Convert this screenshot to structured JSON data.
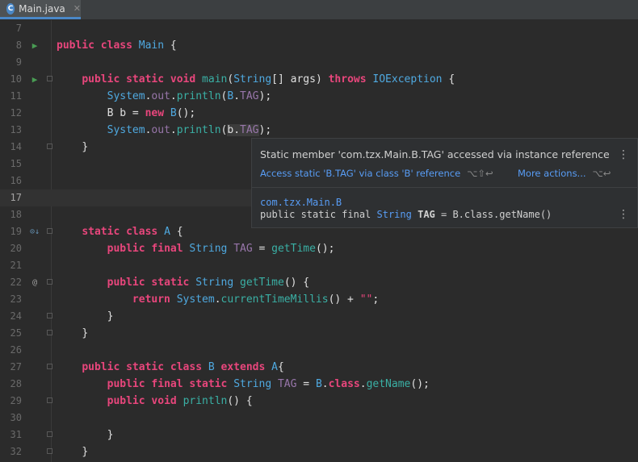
{
  "tab": {
    "icon": "C",
    "title": "Main.java",
    "close_icon": "✕"
  },
  "lines": [
    {
      "n": "7"
    },
    {
      "n": "8"
    },
    {
      "n": "9"
    },
    {
      "n": "10"
    },
    {
      "n": "11"
    },
    {
      "n": "12"
    },
    {
      "n": "13"
    },
    {
      "n": "14"
    },
    {
      "n": "15"
    },
    {
      "n": "16"
    },
    {
      "n": "17"
    },
    {
      "n": "18"
    },
    {
      "n": "19"
    },
    {
      "n": "20"
    },
    {
      "n": "21"
    },
    {
      "n": "22"
    },
    {
      "n": "23"
    },
    {
      "n": "24"
    },
    {
      "n": "25"
    },
    {
      "n": "26"
    },
    {
      "n": "27"
    },
    {
      "n": "28"
    },
    {
      "n": "29"
    },
    {
      "n": "30"
    },
    {
      "n": "31"
    },
    {
      "n": "32"
    }
  ],
  "code": {
    "l8": [
      "public",
      "class",
      "Main",
      "{"
    ],
    "l10": [
      "public",
      "static",
      "void",
      "main",
      "(",
      "String",
      "[] args) ",
      "throws",
      "IOException",
      "{"
    ],
    "l11": [
      "System",
      ".",
      "out",
      ".",
      "println",
      "(",
      "B",
      ".",
      "TAG",
      ");"
    ],
    "l12": [
      "B b = ",
      "new",
      "B",
      "();"
    ],
    "l13": [
      "System",
      ".",
      "out",
      ".",
      "println",
      "(",
      "b",
      ".",
      "TAG",
      ");"
    ],
    "l14": [
      "}"
    ],
    "l19": [
      "static",
      "class",
      "A",
      "{"
    ],
    "l20": [
      "public",
      "final",
      "String",
      "TAG",
      " = ",
      "getTime",
      "();"
    ],
    "l22": [
      "public",
      "static",
      "String",
      "getTime",
      "() {"
    ],
    "l23": [
      "return",
      "System",
      ".",
      "currentTimeMillis",
      "() + ",
      "\"\"",
      ";"
    ],
    "l24": [
      "}"
    ],
    "l25": [
      "}"
    ],
    "l27": [
      "public",
      "static",
      "class",
      "B",
      "extends",
      "A",
      "{"
    ],
    "l28": [
      "public",
      "final",
      "static",
      "String",
      "TAG",
      " = ",
      "B",
      ".",
      "class",
      ".",
      "getName",
      "();"
    ],
    "l29": [
      "public",
      "void",
      "println",
      "() {"
    ],
    "l31": [
      "}"
    ],
    "l32": [
      "}"
    ]
  },
  "gutter_icons": {
    "run": "▶",
    "override": "⊙↓",
    "at": "@"
  },
  "popup": {
    "title": "Static member 'com.tzx.Main.B.TAG' accessed via instance reference",
    "action": "Access static 'B.TAG' via class 'B' reference",
    "action_shortcut": "⌥⇧↩",
    "more": "More actions...",
    "more_shortcut": "⌥↩",
    "decl_class": "com.tzx.Main.B",
    "decl_prefix": "public static final ",
    "decl_type": "String",
    "decl_name": "TAG",
    "decl_rest": " = B.class.getName()",
    "kebab": "⋮"
  }
}
